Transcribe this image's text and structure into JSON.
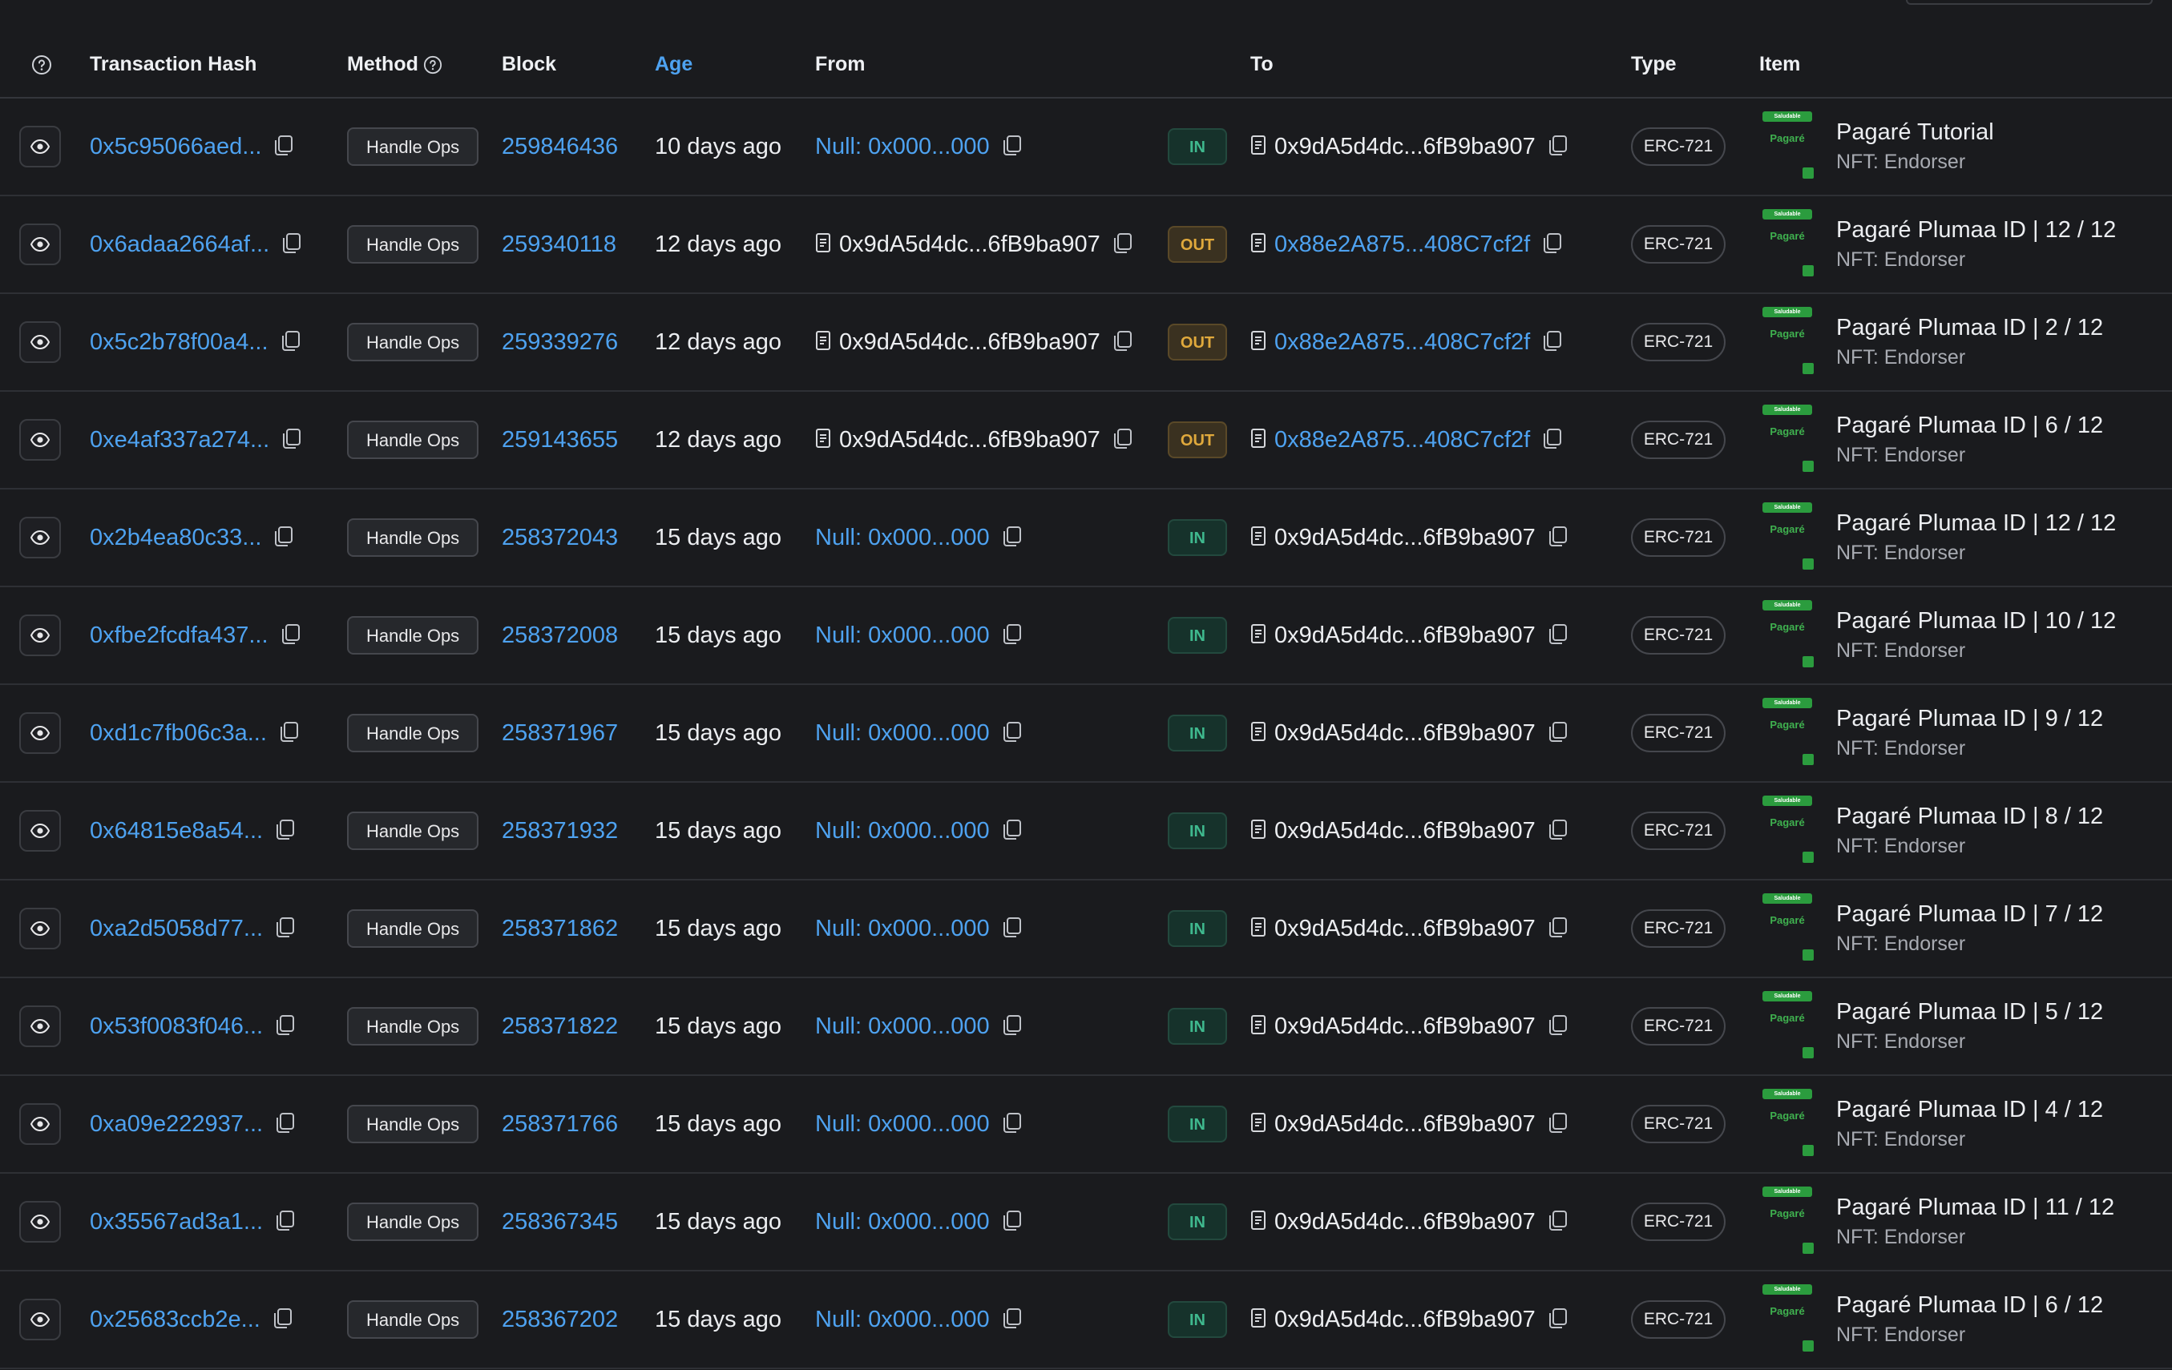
{
  "header": {
    "hash": "Transaction Hash",
    "method": "Method",
    "block": "Block",
    "age": "Age",
    "from": "From",
    "to": "To",
    "type": "Type",
    "item": "Item"
  },
  "colors": {
    "background": "#1a1b1e",
    "link": "#4ea2f0",
    "in_badge": "#3fb98e",
    "out_badge": "#e0a93c",
    "thumb_green": "#2b9c3e"
  },
  "thumb": {
    "tag": "Saludable",
    "name": "Pagaré"
  },
  "rows": [
    {
      "hash": "0x5c95066aed...",
      "method": "Handle Ops",
      "block": "259846436",
      "age": "10 days ago",
      "from": "Null: 0x000...000",
      "from_kind": "null",
      "dir": "IN",
      "to": "0x9dA5d4dc...6fB9ba907",
      "to_kind": "plain",
      "type": "ERC-721",
      "item_name": "Pagaré Tutorial",
      "item_sub": "NFT: Endorser"
    },
    {
      "hash": "0x6adaa2664af...",
      "method": "Handle Ops",
      "block": "259340118",
      "age": "12 days ago",
      "from": "0x9dA5d4dc...6fB9ba907",
      "from_kind": "contract",
      "dir": "OUT",
      "to": "0x88e2A875...408C7cf2f",
      "to_kind": "link",
      "type": "ERC-721",
      "item_name": "Pagaré Plumaa ID | 12 / 12",
      "item_sub": "NFT: Endorser"
    },
    {
      "hash": "0x5c2b78f00a4...",
      "method": "Handle Ops",
      "block": "259339276",
      "age": "12 days ago",
      "from": "0x9dA5d4dc...6fB9ba907",
      "from_kind": "contract",
      "dir": "OUT",
      "to": "0x88e2A875...408C7cf2f",
      "to_kind": "link",
      "type": "ERC-721",
      "item_name": "Pagaré Plumaa ID | 2 / 12",
      "item_sub": "NFT: Endorser"
    },
    {
      "hash": "0xe4af337a274...",
      "method": "Handle Ops",
      "block": "259143655",
      "age": "12 days ago",
      "from": "0x9dA5d4dc...6fB9ba907",
      "from_kind": "contract",
      "dir": "OUT",
      "to": "0x88e2A875...408C7cf2f",
      "to_kind": "link",
      "type": "ERC-721",
      "item_name": "Pagaré Plumaa ID | 6 / 12",
      "item_sub": "NFT: Endorser"
    },
    {
      "hash": "0x2b4ea80c33...",
      "method": "Handle Ops",
      "block": "258372043",
      "age": "15 days ago",
      "from": "Null: 0x000...000",
      "from_kind": "null",
      "dir": "IN",
      "to": "0x9dA5d4dc...6fB9ba907",
      "to_kind": "plain",
      "type": "ERC-721",
      "item_name": "Pagaré Plumaa ID | 12 / 12",
      "item_sub": "NFT: Endorser"
    },
    {
      "hash": "0xfbe2fcdfa437...",
      "method": "Handle Ops",
      "block": "258372008",
      "age": "15 days ago",
      "from": "Null: 0x000...000",
      "from_kind": "null",
      "dir": "IN",
      "to": "0x9dA5d4dc...6fB9ba907",
      "to_kind": "plain",
      "type": "ERC-721",
      "item_name": "Pagaré Plumaa ID | 10 / 12",
      "item_sub": "NFT: Endorser"
    },
    {
      "hash": "0xd1c7fb06c3a...",
      "method": "Handle Ops",
      "block": "258371967",
      "age": "15 days ago",
      "from": "Null: 0x000...000",
      "from_kind": "null",
      "dir": "IN",
      "to": "0x9dA5d4dc...6fB9ba907",
      "to_kind": "plain",
      "type": "ERC-721",
      "item_name": "Pagaré Plumaa ID | 9 / 12",
      "item_sub": "NFT: Endorser"
    },
    {
      "hash": "0x64815e8a54...",
      "method": "Handle Ops",
      "block": "258371932",
      "age": "15 days ago",
      "from": "Null: 0x000...000",
      "from_kind": "null",
      "dir": "IN",
      "to": "0x9dA5d4dc...6fB9ba907",
      "to_kind": "plain",
      "type": "ERC-721",
      "item_name": "Pagaré Plumaa ID | 8 / 12",
      "item_sub": "NFT: Endorser"
    },
    {
      "hash": "0xa2d5058d77...",
      "method": "Handle Ops",
      "block": "258371862",
      "age": "15 days ago",
      "from": "Null: 0x000...000",
      "from_kind": "null",
      "dir": "IN",
      "to": "0x9dA5d4dc...6fB9ba907",
      "to_kind": "plain",
      "type": "ERC-721",
      "item_name": "Pagaré Plumaa ID | 7 / 12",
      "item_sub": "NFT: Endorser"
    },
    {
      "hash": "0x53f0083f046...",
      "method": "Handle Ops",
      "block": "258371822",
      "age": "15 days ago",
      "from": "Null: 0x000...000",
      "from_kind": "null",
      "dir": "IN",
      "to": "0x9dA5d4dc...6fB9ba907",
      "to_kind": "plain",
      "type": "ERC-721",
      "item_name": "Pagaré Plumaa ID | 5 / 12",
      "item_sub": "NFT: Endorser"
    },
    {
      "hash": "0xa09e222937...",
      "method": "Handle Ops",
      "block": "258371766",
      "age": "15 days ago",
      "from": "Null: 0x000...000",
      "from_kind": "null",
      "dir": "IN",
      "to": "0x9dA5d4dc...6fB9ba907",
      "to_kind": "plain",
      "type": "ERC-721",
      "item_name": "Pagaré Plumaa ID | 4 / 12",
      "item_sub": "NFT: Endorser"
    },
    {
      "hash": "0x35567ad3a1...",
      "method": "Handle Ops",
      "block": "258367345",
      "age": "15 days ago",
      "from": "Null: 0x000...000",
      "from_kind": "null",
      "dir": "IN",
      "to": "0x9dA5d4dc...6fB9ba907",
      "to_kind": "plain",
      "type": "ERC-721",
      "item_name": "Pagaré Plumaa ID | 11 / 12",
      "item_sub": "NFT: Endorser"
    },
    {
      "hash": "0x25683ccb2e...",
      "method": "Handle Ops",
      "block": "258367202",
      "age": "15 days ago",
      "from": "Null: 0x000...000",
      "from_kind": "null",
      "dir": "IN",
      "to": "0x9dA5d4dc...6fB9ba907",
      "to_kind": "plain",
      "type": "ERC-721",
      "item_name": "Pagaré Plumaa ID | 6 / 12",
      "item_sub": "NFT: Endorser"
    }
  ]
}
